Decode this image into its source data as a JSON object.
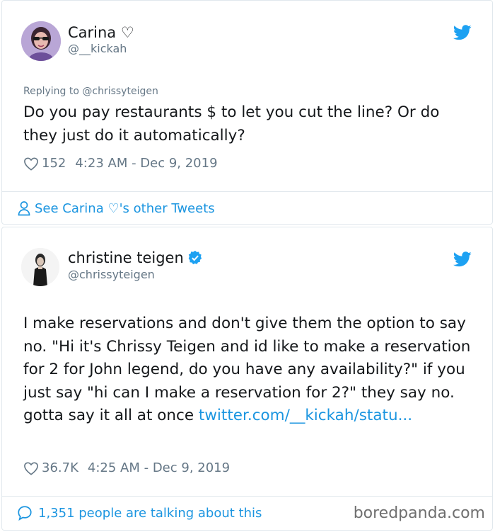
{
  "tweet1": {
    "author_name": "Carina ♡",
    "handle": "@__kickah",
    "replying_to": "Replying to @chrissyteigen",
    "text": "Do you pay restaurants $ to let you cut the line? Or do they just do it automatically?",
    "likes": "152",
    "timestamp": "4:23 AM - Dec 9, 2019",
    "see_other": "See Carina ♡'s other Tweets"
  },
  "tweet2": {
    "author_name": "christine teigen",
    "handle": "@chrissyteigen",
    "text": "I make reservations and don't give them the option to say no. \"Hi it's Chrissy Teigen and id like to make a reservation for 2 for John legend, do you have any availability?\" if you just say \"hi can I make a reservation for 2?\" they say no. gotta say it all at once ",
    "link": "twitter.com/__kickah/statu...",
    "likes": "36.7K",
    "timestamp": "4:25 AM - Dec 9, 2019",
    "talking": "1,351 people are talking about this",
    "verified_icon": "verified-badge-icon"
  },
  "watermark": "boredpanda.com",
  "colors": {
    "link": "#1b95e0",
    "muted": "#657786",
    "text": "#14171a",
    "border": "#e1e8ed"
  }
}
